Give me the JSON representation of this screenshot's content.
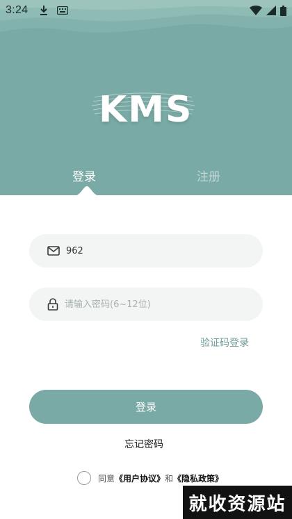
{
  "status_bar": {
    "time": "3:24",
    "left_icons": [
      "download-icon",
      "keyboard-icon"
    ],
    "right_icons": [
      "wifi-icon",
      "signal-icon",
      "battery-icon"
    ]
  },
  "brand": {
    "logo_text": "KMS",
    "hero_color": "#79aaa5"
  },
  "tabs": [
    {
      "label": "登录",
      "active": true
    },
    {
      "label": "注册",
      "active": false
    }
  ],
  "form": {
    "email_value": "962",
    "email_icon": "mail-icon",
    "password_placeholder": "请输入密码(6~12位)",
    "password_icon": "lock-icon",
    "code_login_link": "验证码登录",
    "submit_label": "登录",
    "forgot_label": "忘记密码"
  },
  "agreement": {
    "prefix": "同意",
    "user_agreement": "《用户协议》",
    "conjunction": "和",
    "privacy_policy": "《隐私政策》"
  },
  "watermark": {
    "text": "就收资源站"
  }
}
